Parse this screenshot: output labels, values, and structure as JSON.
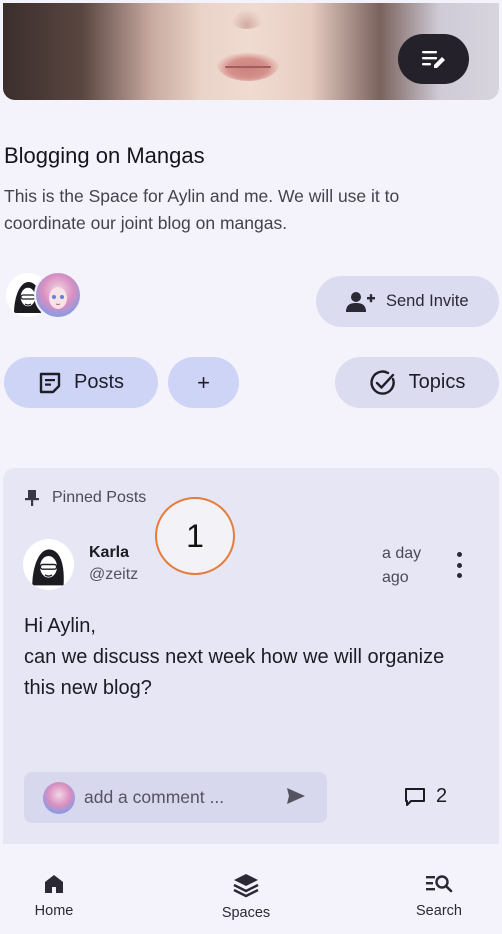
{
  "banner": {
    "image_alt": "manga character face",
    "edit_icon": "edit-note-icon"
  },
  "space": {
    "title": "Blogging on Mangas",
    "description": "This is the Space for Aylin and me. We will use it to coordinate our joint blog on mangas."
  },
  "actions": {
    "send_invite_label": "Send Invite",
    "posts_label": "Posts",
    "add_label": "+",
    "topics_label": "Topics"
  },
  "pinned": {
    "label": "Pinned Posts",
    "marker": "1",
    "post": {
      "author_name": "Karla",
      "author_handle": "@zeitz",
      "time": "a day ago",
      "body": "Hi Aylin,\ncan we discuss next week how we will organize this new blog?",
      "comment_placeholder": "add a comment ...",
      "comment_count": "2"
    }
  },
  "nav": {
    "home": "Home",
    "spaces": "Spaces",
    "search": "Search"
  },
  "colors": {
    "background": "#f4f3fb",
    "primary_pill": "#cdd4f6",
    "secondary_pill": "#dcdcf0",
    "card": "#e6e6f4",
    "marker_border": "#e67c3c"
  }
}
